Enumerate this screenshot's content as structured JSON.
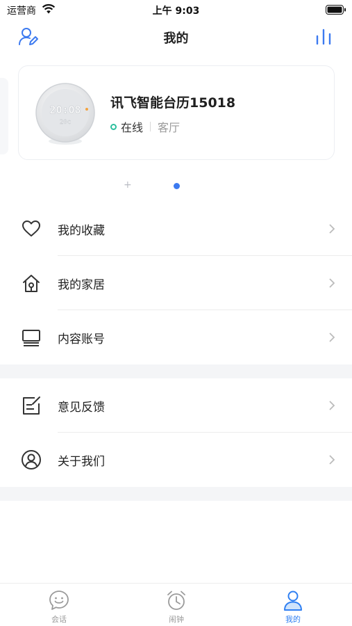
{
  "status_bar": {
    "carrier": "运营商",
    "time": "上午 9:03"
  },
  "nav": {
    "title": "我的"
  },
  "device": {
    "name": "讯飞智能台历15018",
    "status": "在线",
    "room": "客厅",
    "screen_time": "20:08",
    "screen_temp": "20c"
  },
  "pager": {
    "add_symbol": "+"
  },
  "menu": {
    "favorites": "我的收藏",
    "home": "我的家居",
    "content_account": "内容账号",
    "feedback": "意见反馈",
    "about": "关于我们"
  },
  "tabbar": {
    "chat": "会话",
    "alarm": "闹钟",
    "mine": "我的"
  },
  "colors": {
    "accent": "#2f7ff2",
    "online": "#2bbf9d",
    "pager_active": "#3c7af0"
  }
}
